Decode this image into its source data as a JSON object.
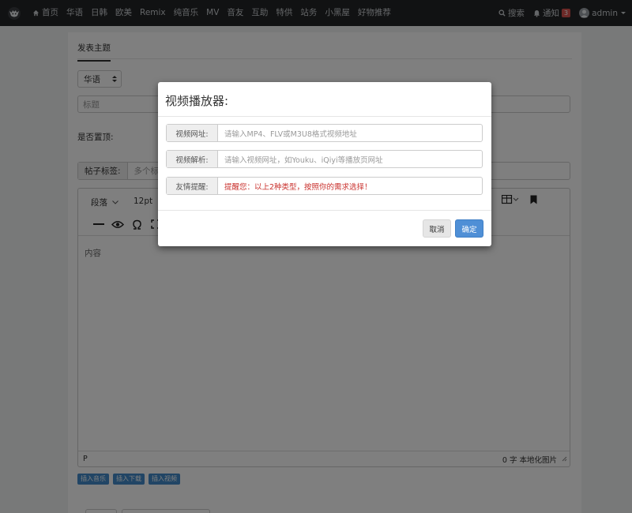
{
  "nav": {
    "items": [
      {
        "label": "首页",
        "icon": "home-icon"
      },
      {
        "label": "华语"
      },
      {
        "label": "日韩"
      },
      {
        "label": "欧美"
      },
      {
        "label": "Remix"
      },
      {
        "label": "纯音乐"
      },
      {
        "label": "MV"
      },
      {
        "label": "音友"
      },
      {
        "label": "互助"
      },
      {
        "label": "特供"
      },
      {
        "label": "站务"
      },
      {
        "label": "小黑屋"
      },
      {
        "label": "好物推荐"
      }
    ],
    "search_label": "搜索",
    "notify_label": "通知",
    "notify_count": "3",
    "user_label": "admin"
  },
  "form": {
    "tab_label": "发表主题",
    "category_value": "华语",
    "title_placeholder": "标题",
    "sticky_label": "是否置顶:",
    "tags_label": "帖子标签:",
    "tags_placeholder": "多个标"
  },
  "editor": {
    "block_format": "段落",
    "font_size": "12pt",
    "content_placeholder": "内容",
    "path": "P",
    "word_count": "0 字",
    "local_images": "本地化图片"
  },
  "insert_buttons": [
    "插入音乐",
    "插入下载",
    "插入视频"
  ],
  "modal": {
    "title": "视频播放器:",
    "rows": [
      {
        "label": "视频网址:",
        "placeholder": "请输入MP4、FLV或M3U8格式视频地址"
      },
      {
        "label": "视频解析:",
        "placeholder": "请输入视频网址，如Youku、iQiyi等播放页网址"
      },
      {
        "label": "友情提醒:",
        "value": "提醒您：以上2种类型，按照你的需求选择！"
      }
    ],
    "cancel_label": "取消",
    "ok_label": "确定"
  },
  "colors": {
    "navbar": "#222426",
    "primary": "#4f8fd6",
    "warning_text": "#c9302c",
    "badge": "#d9534f"
  }
}
